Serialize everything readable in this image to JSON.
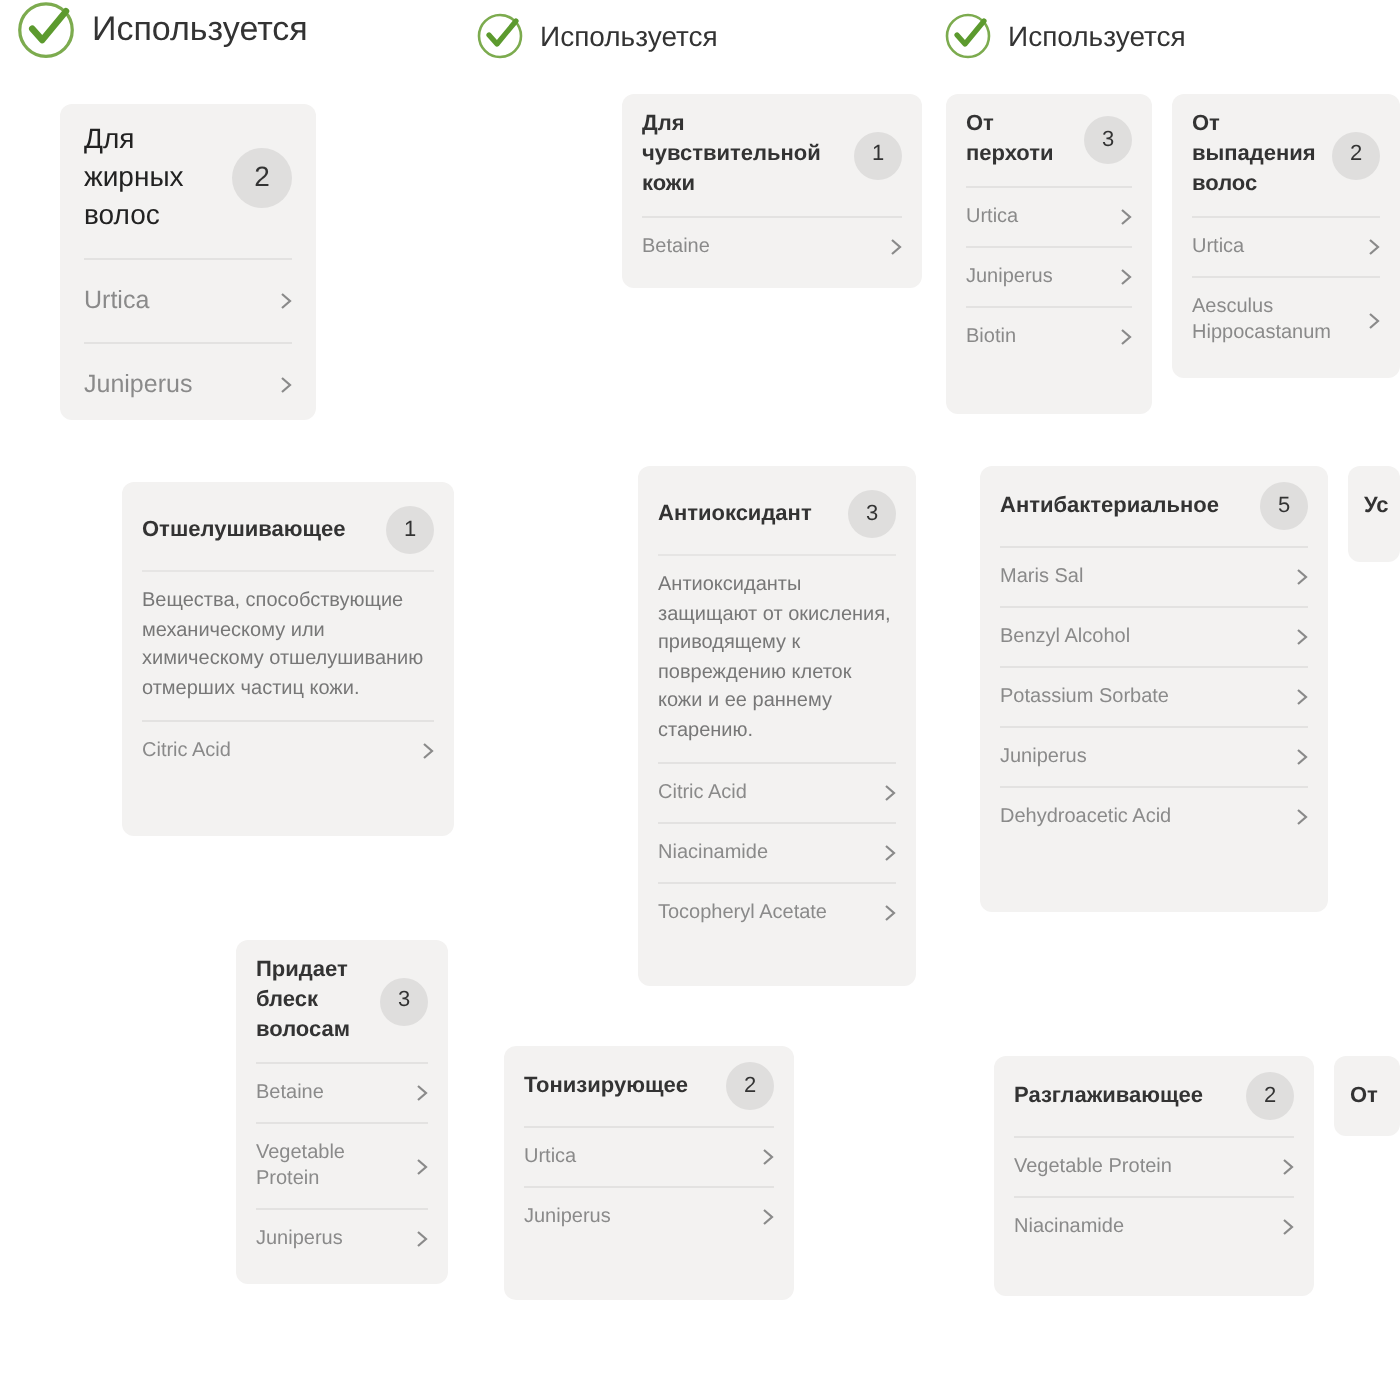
{
  "headings": [
    {
      "label": "Используется"
    },
    {
      "label": "Используется"
    },
    {
      "label": "Используется"
    }
  ],
  "cards": [
    {
      "title": "Для жирных волос",
      "count": "2",
      "items": [
        "Urtica",
        "Juniperus"
      ]
    },
    {
      "title": "Для чувствительной кожи",
      "count": "1",
      "items": [
        "Betaine"
      ]
    },
    {
      "title": "От перхоти",
      "count": "3",
      "items": [
        "Urtica",
        "Juniperus",
        "Biotin"
      ]
    },
    {
      "title": "От выпадения волос",
      "count": "2",
      "items": [
        "Urtica",
        "Aesculus Hippocastanum"
      ]
    },
    {
      "title": "Отшелушивающее",
      "count": "1",
      "description": "Вещества, способствующие механическому или химическому отшелушиванию отмерших частиц кожи.",
      "items": [
        "Citric Acid"
      ]
    },
    {
      "title": "Антиоксидант",
      "count": "3",
      "description": "Антиоксиданты защищают от окисления, приводящему к повреждению клеток кожи и ее раннему старению.",
      "items": [
        "Citric Acid",
        "Niacinamide",
        "Tocopheryl Acetate"
      ]
    },
    {
      "title": "Антибактериальное",
      "count": "5",
      "items": [
        "Maris Sal",
        "Benzyl Alcohol",
        "Potassium Sorbate",
        "Juniperus",
        "Dehydroacetic Acid"
      ]
    },
    {
      "title": "Ус"
    },
    {
      "title": "Придает блеск волосам",
      "count": "3",
      "items": [
        "Betaine",
        "Vegetable Protein",
        "Juniperus"
      ]
    },
    {
      "title": "Тонизирующее",
      "count": "2",
      "items": [
        "Urtica",
        "Juniperus"
      ]
    },
    {
      "title": "Разглаживающее",
      "count": "2",
      "items": [
        "Vegetable Protein",
        "Niacinamide"
      ]
    },
    {
      "title": "От"
    }
  ]
}
